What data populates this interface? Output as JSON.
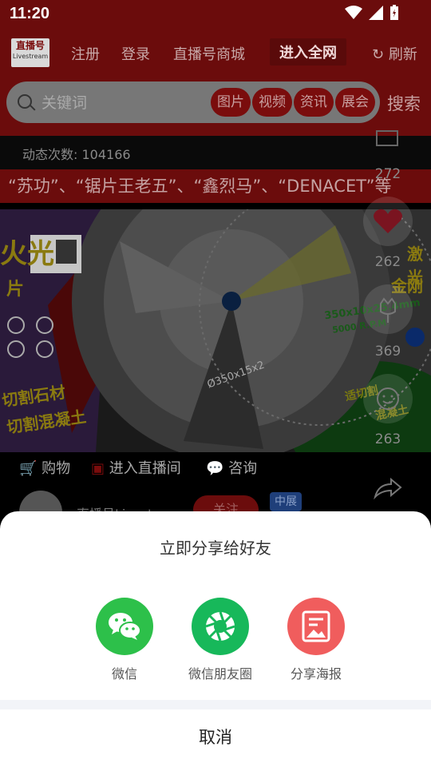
{
  "status_bar": {
    "time": "11:20"
  },
  "nav": {
    "logo_line1": "直播号",
    "logo_line2": "Livestream",
    "items": [
      "注册",
      "登录",
      "直播号商城",
      "进入全网"
    ],
    "refresh": "刷新"
  },
  "search": {
    "placeholder": "关键词",
    "chips": [
      "图片",
      "视频",
      "资讯",
      "展会"
    ],
    "button": "搜索"
  },
  "feed": {
    "dynamic_count": "动态次数: 104166",
    "marquee": "“苏功”、“锯片王老五”、“鑫烈马”、“DENACET”等",
    "video_text": {
      "left_big": "火光",
      "left_sub": "片",
      "cut_stone": "切割石材",
      "cut_concrete": "切割混凝土",
      "right_top": "激光",
      "right_mid": "金刚",
      "spec": "350x10x25.4mm",
      "rpm": "5000 R.P.M",
      "center": "Ø350x15x2",
      "right_low1": "适切割",
      "right_low2": "混凝土"
    },
    "actions": [
      "购物",
      "进入直播间",
      "咨询"
    ],
    "author_name": "直播号Livestream",
    "follow": "关注",
    "tag": "中展"
  },
  "sidebar": {
    "counts": [
      "272",
      "262",
      "369",
      "263"
    ]
  },
  "share_sheet": {
    "title": "立即分享给好友",
    "options": [
      {
        "label": "微信",
        "color": "#2dc04a",
        "icon": "wechat-icon"
      },
      {
        "label": "微信朋友圈",
        "color": "#17b85a",
        "icon": "moments-icon"
      },
      {
        "label": "分享海报",
        "color": "#f05d5d",
        "icon": "poster-icon"
      }
    ],
    "cancel": "取消"
  }
}
